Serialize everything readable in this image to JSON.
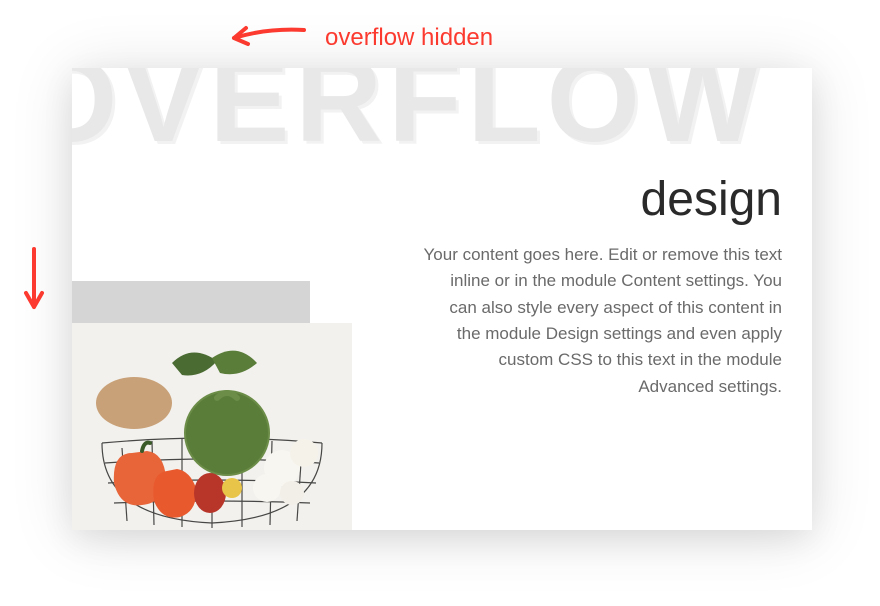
{
  "annotation": {
    "label": "overflow hidden"
  },
  "card": {
    "overflow_text": "OVERFLOW",
    "heading": "design",
    "body_text": "Your content goes here. Edit or remove this text inline or in the module Content settings. You can also style every aspect of this content in the module Design settings and even apply custom CSS to this text in the module Advanced settings."
  }
}
